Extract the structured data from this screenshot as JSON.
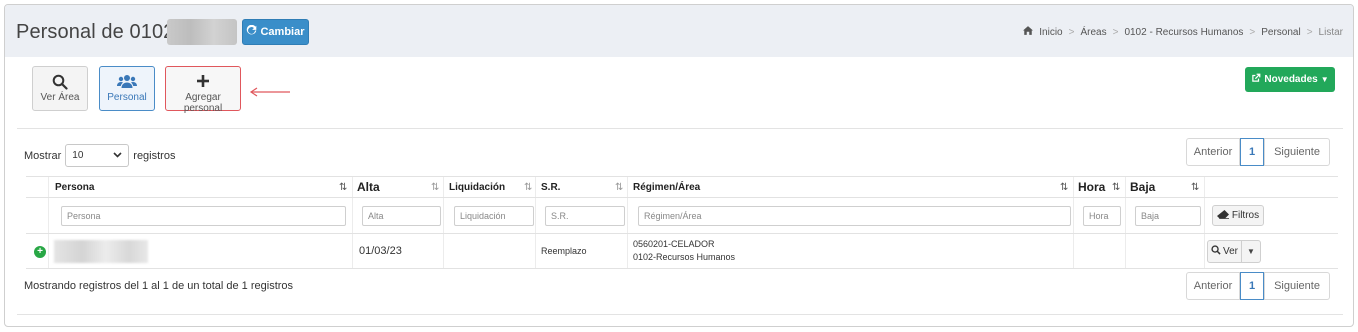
{
  "header": {
    "title": "Personal de 0102 -",
    "change_button": "Cambiar",
    "breadcrumb": [
      "Inicio",
      "Áreas",
      "0102 - Recursos Humanos",
      "Personal",
      "Listar"
    ]
  },
  "toolbar": {
    "items": [
      {
        "label": "Ver Área",
        "icon": "search-icon"
      },
      {
        "label": "Personal",
        "icon": "users-icon"
      },
      {
        "label": "Agregar personal",
        "icon": "plus-icon"
      }
    ],
    "novedades_button": "Novedades"
  },
  "length_menu": {
    "prefix": "Mostrar",
    "value": "10",
    "suffix": "registros"
  },
  "pagination": {
    "prev": "Anterior",
    "page": "1",
    "next": "Siguiente"
  },
  "table": {
    "columns": [
      "Persona",
      "Alta",
      "Liquidación",
      "S.R.",
      "Régimen/Área",
      "Hora",
      "Baja"
    ],
    "filters": [
      "Persona",
      "Alta",
      "Liquidación",
      "S.R.",
      "Régimen/Área",
      "Hora",
      "Baja"
    ],
    "filter_button": "Filtros",
    "rows": [
      {
        "persona": "",
        "alta": "01/03/23",
        "liquidacion": "",
        "sr": "Reemplazo",
        "regimen_line1": "0560201-CELADOR",
        "regimen_line2": "0102-Recursos Humanos",
        "hora": "",
        "baja": "",
        "action": "Ver"
      }
    ]
  },
  "info": "Mostrando registros del 1 al 1 de un total de 1 registros",
  "colors": {
    "primary": "#3a8ec9",
    "success": "#22a85a",
    "highlight": "#e0575c"
  }
}
